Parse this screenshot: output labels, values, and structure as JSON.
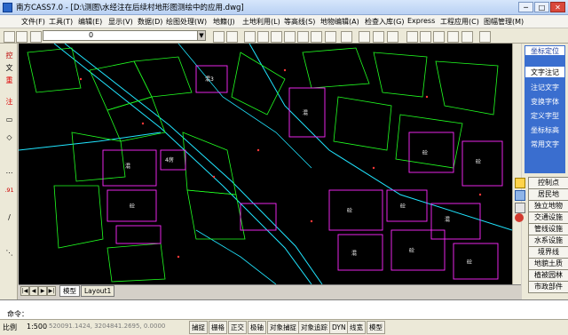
{
  "window": {
    "title": "南方CASS7.0 - [D:\\测图\\水经注在后续村地形图测绘中的应用.dwg]",
    "min_label": "─",
    "max_label": "□",
    "close_label": "✕"
  },
  "menu": [
    "文件(F)",
    "工具(T)",
    "编辑(E)",
    "显示(V)",
    "数据(D)",
    "绘图处理(W)",
    "地籍(J)",
    "土地利用(L)",
    "等高线(S)",
    "地物编辑(A)",
    "检查入库(G)",
    "Express",
    "工程应用(C)",
    "图幅管理(M)"
  ],
  "toolbar": {
    "layer_value": "0",
    "combo_arrow": "▼"
  },
  "left_tools": [
    "控",
    "文",
    "重",
    "注",
    "▭",
    "◇",
    "⋯",
    ".91",
    "∕",
    "⋱"
  ],
  "drawing": {
    "lot_labels": [
      "混",
      "砼",
      "4房",
      "混3",
      "混",
      "砼",
      "砼",
      "混",
      "混",
      "砼",
      "砼",
      "砼",
      "砼"
    ],
    "colors": {
      "background": "#000000",
      "green": "#21ff21",
      "magenta": "#ff2aff",
      "cyan": "#20e5ff",
      "red": "#ff3838",
      "white": "#ffffff"
    }
  },
  "tabs": {
    "nav": [
      "|◀",
      "◀",
      "▶",
      "▶|"
    ],
    "items": [
      "模型",
      "Layout1"
    ]
  },
  "right_panel": {
    "header": "坐标定位",
    "blue_items": [
      "文字注记",
      "注记文字",
      "变换字体",
      "定义字型",
      "坐标标高",
      "常用文字"
    ],
    "buttons": [
      "控制点",
      "居民地",
      "独立地物",
      "交通设施",
      "管线设施",
      "水系设施",
      "境界线",
      "地貌土质",
      "植被园林",
      "市政部件"
    ]
  },
  "command": {
    "label": "命令："
  },
  "status": {
    "scale_label": "比例",
    "scale_value": "1:500",
    "coords": "520091.1424, 3204841.2695, 0.0000",
    "toggles": [
      "捕捉",
      "栅格",
      "正交",
      "极轴",
      "对象捕捉",
      "对象追踪",
      "DYN",
      "线宽",
      "模型"
    ]
  }
}
